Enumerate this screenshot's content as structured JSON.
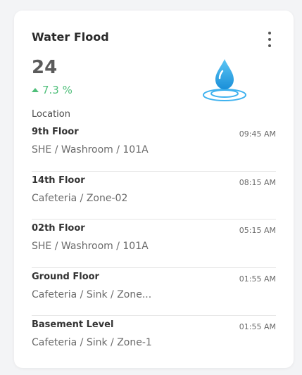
{
  "card": {
    "title": "Water Flood",
    "count": "24",
    "trend": "7.3 %",
    "section_label": "Location",
    "icon": "water-drop-icon",
    "colors": {
      "accent": "#2aa7e8",
      "trend_up": "#4fbf7a"
    }
  },
  "items": [
    {
      "name": "9th Floor",
      "path": "SHE / Washroom / 101A",
      "time": "09:45 AM"
    },
    {
      "name": "14th Floor",
      "path": "Cafeteria / Zone-02",
      "time": "08:15 AM"
    },
    {
      "name": "02th Floor",
      "path": "SHE / Washroom / 101A",
      "time": "05:15 AM"
    },
    {
      "name": "Ground Floor",
      "path": "Cafeteria / Sink / Zone...",
      "time": "01:55 AM"
    },
    {
      "name": "Basement Level",
      "path": "Cafeteria / Sink / Zone-1",
      "time": "01:55 AM"
    }
  ]
}
